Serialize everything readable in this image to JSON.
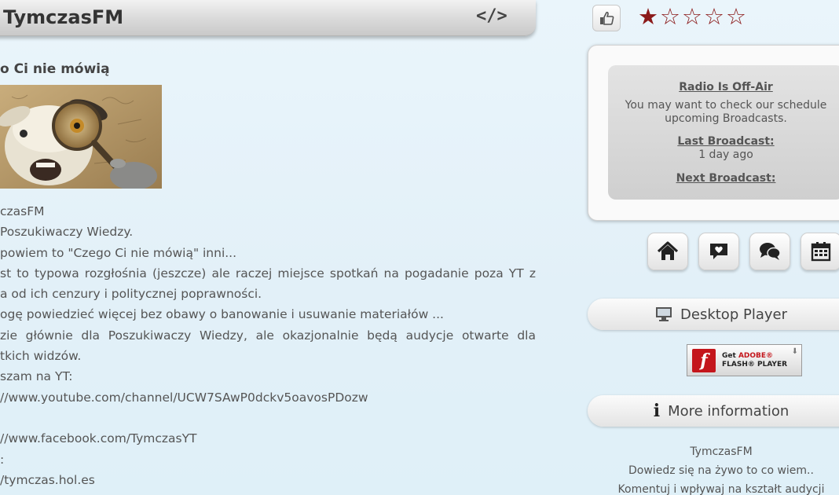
{
  "header": {
    "title": "TymczasFM",
    "embed_icon": "code-embed-icon"
  },
  "post": {
    "heading": "o Ci nie mówią",
    "lines": [
      "czasFM",
      "Poszukiwaczy Wiedzy.",
      "powiem to \"Czego Ci nie mówią\" inni...",
      "st to typowa rozgłośnia (jeszcze) ale raczej miejsce spotkań na pogadanie poza YT z",
      "a od ich cenzury i politycznej poprawności.",
      "ogę powiedzieć więcej bez obawy o banowanie i usuwanie materiałów ...",
      "zie głównie dla Poszukiwaczy Wiedzy, ale okazjonalnie będą audycje otwarte dla",
      "tkich widzów.",
      "szam na YT:",
      "//www.youtube.com/channel/UCW7SAwP0dckv5oavosPDozw",
      "",
      "//www.facebook.com/TymczasYT",
      ":",
      "/tymczas.hol.es"
    ]
  },
  "rating": {
    "value": 1,
    "max": 5,
    "filled_color": "#8b1a1a",
    "like_icon": "thumbs-up-icon"
  },
  "status": {
    "title": "Radio Is Off-Air",
    "message_line1": "You may want to check our schedule",
    "message_line2": "upcoming Broadcasts.",
    "last_label": "Last Broadcast:",
    "last_value": "1 day ago",
    "next_label": "Next Broadcast:"
  },
  "nav": [
    {
      "name": "home-icon"
    },
    {
      "name": "heart-message-icon"
    },
    {
      "name": "chat-icon"
    },
    {
      "name": "calendar-icon"
    }
  ],
  "desktop_player": {
    "label": "Desktop Player",
    "icon": "monitor-icon"
  },
  "flash": {
    "line1_prefix": "Get",
    "line1_brand": "ADOBE®",
    "line2": "FLASH® PLAYER",
    "logo": "f"
  },
  "more_info": {
    "label": "More information",
    "icon": "info-icon"
  },
  "station": {
    "name": "TymczasFM",
    "line2": "Dowiedz się na żywo to co wiem..",
    "line3": "Komentuj i wpływaj na kształt audycji"
  }
}
